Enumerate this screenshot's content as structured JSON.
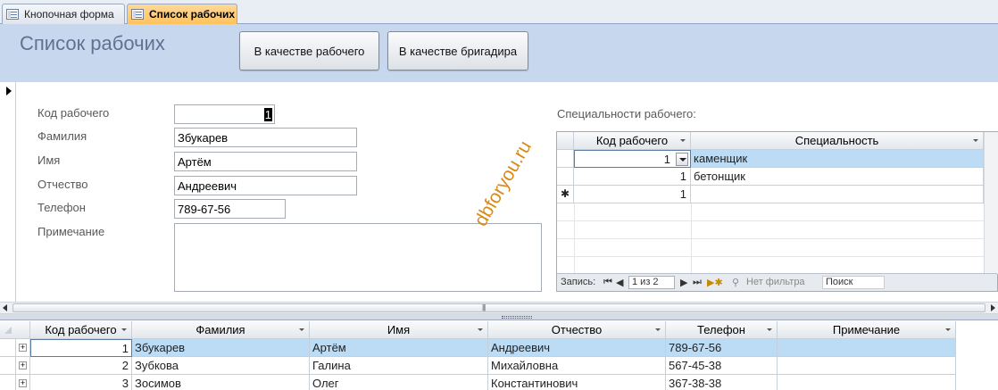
{
  "tabs": [
    {
      "label": "Кнопочная форма",
      "active": false
    },
    {
      "label": "Список рабочих",
      "active": true
    }
  ],
  "header": {
    "title": "Список рабочих",
    "btn_worker": "В качестве рабочего",
    "btn_foreman": "В качестве бригадира"
  },
  "form": {
    "labels": {
      "code": "Код рабочего",
      "lastname": "Фамилия",
      "firstname": "Имя",
      "patronymic": "Отчество",
      "phone": "Телефон",
      "note": "Примечание"
    },
    "values": {
      "code": "1",
      "lastname": "Збукарев",
      "firstname": "Артём",
      "patronymic": "Андреевич",
      "phone": "789-67-56",
      "note": ""
    }
  },
  "watermark": "dbforyou.ru",
  "subform": {
    "caption": "Специальности рабочего:",
    "col_code": "Код рабочего",
    "col_specialty": "Специальность",
    "rows": [
      {
        "code": "1",
        "specialty": "каменщик"
      },
      {
        "code": "1",
        "specialty": "бетонщик"
      }
    ],
    "new_row_marker": "✱",
    "new_row_code": "1",
    "nav": {
      "record_label": "Запись:",
      "position": "1 из 2",
      "filter": "Нет фильтра",
      "search_placeholder": "Поиск"
    }
  },
  "datasheet": {
    "columns": [
      "Код рабочего",
      "Фамилия",
      "Имя",
      "Отчество",
      "Телефон",
      "Примечание"
    ],
    "rows": [
      {
        "code": "1",
        "lastname": "Збукарев",
        "firstname": "Артём",
        "patronymic": "Андреевич",
        "phone": "789-67-56",
        "note": ""
      },
      {
        "code": "2",
        "lastname": "Зубкова",
        "firstname": "Галина",
        "patronymic": "Михайловна",
        "phone": "567-45-38",
        "note": ""
      },
      {
        "code": "3",
        "lastname": "Зосимов",
        "firstname": "Олег",
        "patronymic": "Константинович",
        "phone": "367-38-38",
        "note": ""
      }
    ]
  },
  "colors": {
    "header_bg": "#c7d7ee",
    "active_tab": "#ffc35c",
    "selection": "#bcdcf6",
    "watermark": "#d98a17"
  }
}
